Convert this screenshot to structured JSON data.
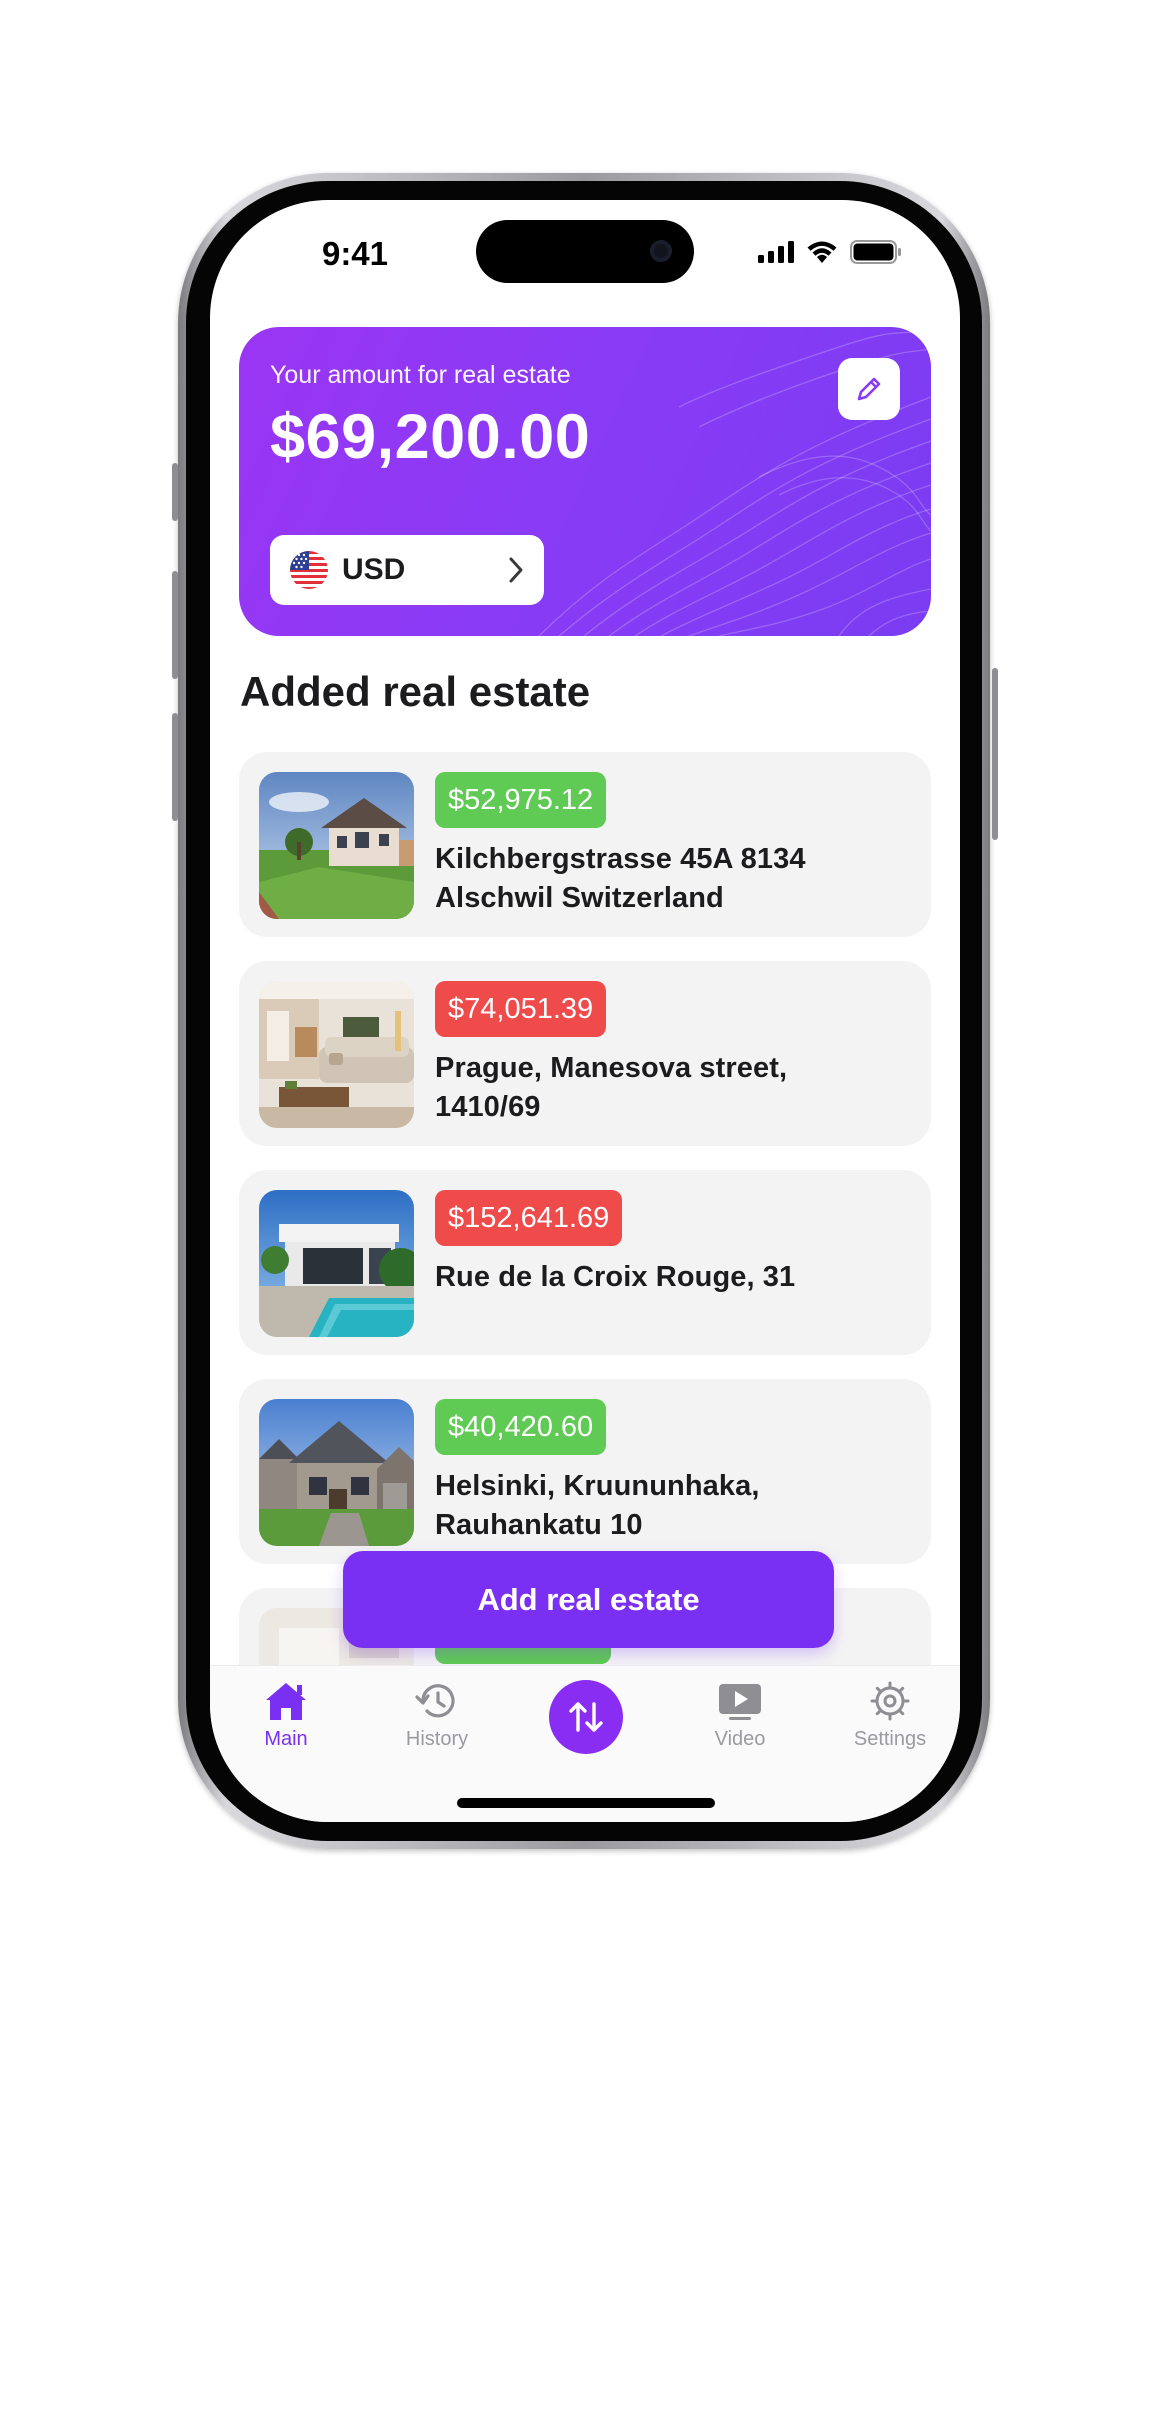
{
  "status_bar": {
    "time": "9:41"
  },
  "balance_card": {
    "label": "Your amount for real estate",
    "amount": "$69,200.00",
    "currency_code": "USD"
  },
  "section_title": "Added real estate",
  "properties": [
    {
      "price": "$52,975.12",
      "price_status": "green",
      "address": "Kilchbergstrasse 45A 8134 Alschwil Switzerland"
    },
    {
      "price": "$74,051.39",
      "price_status": "red",
      "address": "Prague, Manesova street, 1410/69"
    },
    {
      "price": "$152,641.69",
      "price_status": "red",
      "address": "Rue de la Croix Rouge, 31"
    },
    {
      "price": "$40,420.60",
      "price_status": "green",
      "address": "Helsinki, Kruununhaka, Rauhankatu 10"
    }
  ],
  "add_button_label": "Add real estate",
  "tabs": [
    {
      "label": "Main",
      "icon": "house-icon",
      "active": true
    },
    {
      "label": "History",
      "icon": "history-clock-icon",
      "active": false
    },
    {
      "label": "",
      "icon": "swap-arrows-icon",
      "active": false
    },
    {
      "label": "Video",
      "icon": "video-play-icon",
      "active": false
    },
    {
      "label": "Settings",
      "icon": "gear-icon",
      "active": false
    }
  ],
  "colors": {
    "accent": "#7a30f2",
    "price_up": "#5fcb55",
    "price_down": "#ef4b4b",
    "card_bg": "#f3f3f4"
  }
}
